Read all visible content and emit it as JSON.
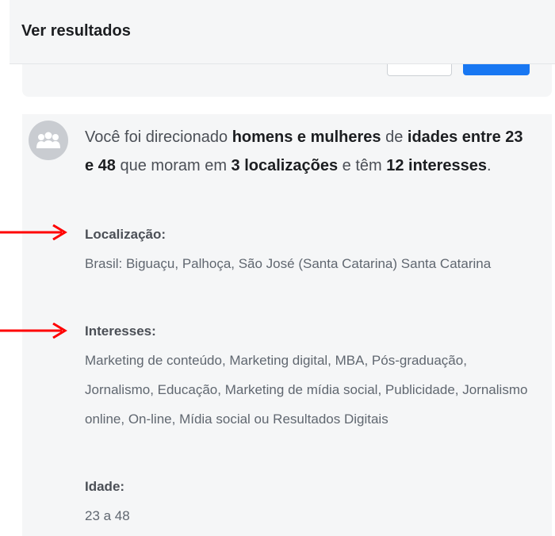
{
  "header": {
    "title": "Ver resultados"
  },
  "summary": {
    "p1": "Você foi direcionado ",
    "b1": "homens e mulheres",
    "p2": " de ",
    "b2": "idades entre 23 e 48",
    "p3": " que moram em ",
    "b3": "3 localizações",
    "p4": " e têm ",
    "b4": "12 interesses",
    "p5": "."
  },
  "location": {
    "label": "Localização:",
    "value": "Brasil: Biguaçu, Palhoça, São José (Santa Catarina) Santa Catarina"
  },
  "interests": {
    "label": "Interesses:",
    "value": "Marketing de conteúdo, Marketing digital, MBA, Pós-graduação, Jornalismo, Educação, Marketing de mídia social, Publicidade, Jornalismo online, On-line, Mídia social ou Resultados Digitais"
  },
  "age": {
    "label": "Idade:",
    "value": "23 a 48"
  },
  "icons": {
    "avatar": "people-group-icon",
    "arrow": "red-arrow-icon"
  },
  "colors": {
    "arrow": "#ff0000",
    "primary_button": "#1877f2",
    "card_background": "#f5f6f7"
  }
}
